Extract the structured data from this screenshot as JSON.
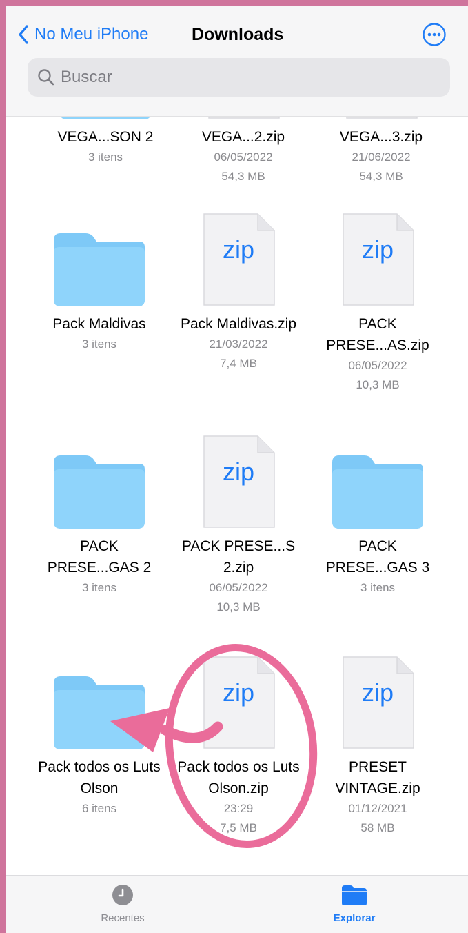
{
  "header": {
    "back_label": "No Meu iPhone",
    "title": "Downloads",
    "more_icon": "ellipsis-circle-icon"
  },
  "search": {
    "placeholder": "Buscar"
  },
  "items": [
    {
      "kind": "folder",
      "name": "VEGA...SON 2",
      "count": "3 itens"
    },
    {
      "kind": "zip",
      "name": "VEGA...2.zip",
      "date": "06/05/2022",
      "size": "54,3 MB",
      "icon_text": "zip"
    },
    {
      "kind": "zip",
      "name": "VEGA...3.zip",
      "date": "21/06/2022",
      "size": "54,3 MB",
      "icon_text": "zip"
    },
    {
      "kind": "folder",
      "name": "Pack Maldivas",
      "count": "3 itens"
    },
    {
      "kind": "zip",
      "name": "Pack Maldivas.zip",
      "date": "21/03/2022",
      "size": "7,4 MB",
      "icon_text": "zip"
    },
    {
      "kind": "zip",
      "name": "PACK PRESE...AS.zip",
      "date": "06/05/2022",
      "size": "10,3 MB",
      "icon_text": "zip"
    },
    {
      "kind": "folder",
      "name": "PACK PRESE...GAS 2",
      "count": "3 itens"
    },
    {
      "kind": "zip",
      "name": "PACK PRESE...S 2.zip",
      "date": "06/05/2022",
      "size": "10,3 MB",
      "icon_text": "zip"
    },
    {
      "kind": "folder",
      "name": "PACK PRESE...GAS 3",
      "count": "3 itens"
    },
    {
      "kind": "folder",
      "name": "Pack todos os Luts Olson",
      "count": "6 itens"
    },
    {
      "kind": "zip",
      "name": "Pack todos os Luts Olson.zip",
      "date": "23:29",
      "size": "7,5 MB",
      "icon_text": "zip"
    },
    {
      "kind": "zip",
      "name": "PRESET VINTAGE.zip",
      "date": "01/12/2021",
      "size": "58 MB",
      "icon_text": "zip"
    }
  ],
  "tabs": [
    {
      "label": "Recentes",
      "icon": "clock-icon",
      "active": false
    },
    {
      "label": "Explorar",
      "icon": "folder-icon",
      "active": true
    }
  ],
  "colors": {
    "accent": "#1f7cf6",
    "annotation": "#ea6c9a",
    "border": "#cf749c",
    "folder": "#82cdf8"
  }
}
